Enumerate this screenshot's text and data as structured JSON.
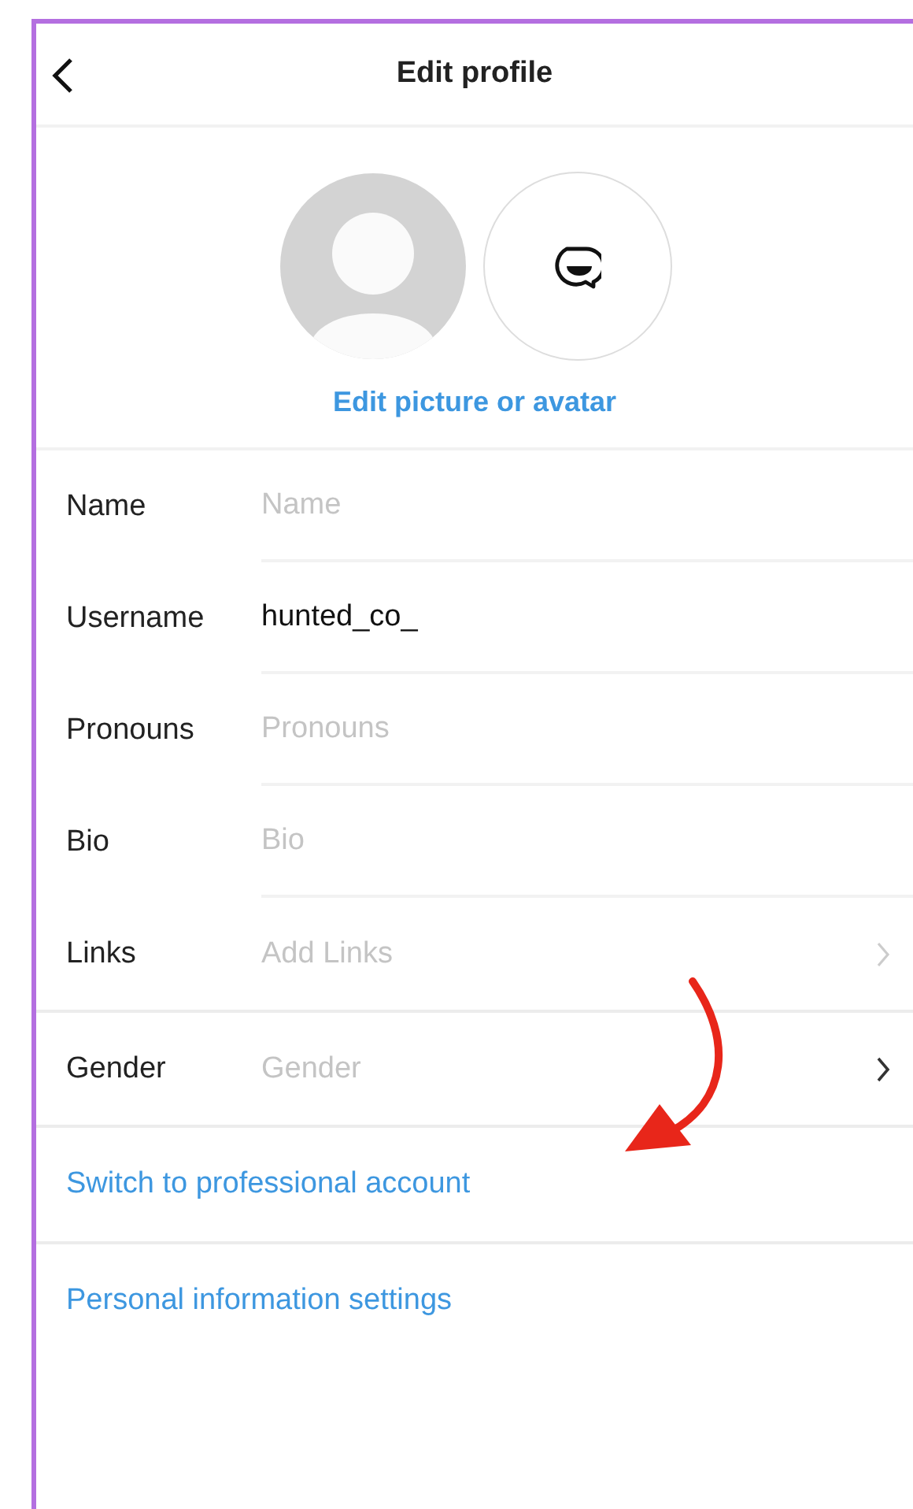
{
  "header": {
    "title": "Edit profile"
  },
  "avatar": {
    "edit_link": "Edit picture or avatar"
  },
  "fields": [
    {
      "kind": "text",
      "label": "Name",
      "placeholder": "Name"
    },
    {
      "kind": "text",
      "label": "Username",
      "value": "hunted_co_"
    },
    {
      "kind": "text",
      "label": "Pronouns",
      "placeholder": "Pronouns"
    },
    {
      "kind": "text",
      "label": "Bio",
      "placeholder": "Bio"
    },
    {
      "kind": "link",
      "label": "Links",
      "placeholder": "Add Links"
    }
  ],
  "gender": {
    "label": "Gender",
    "placeholder": "Gender"
  },
  "links": [
    "Switch to professional account",
    "Personal information settings"
  ]
}
